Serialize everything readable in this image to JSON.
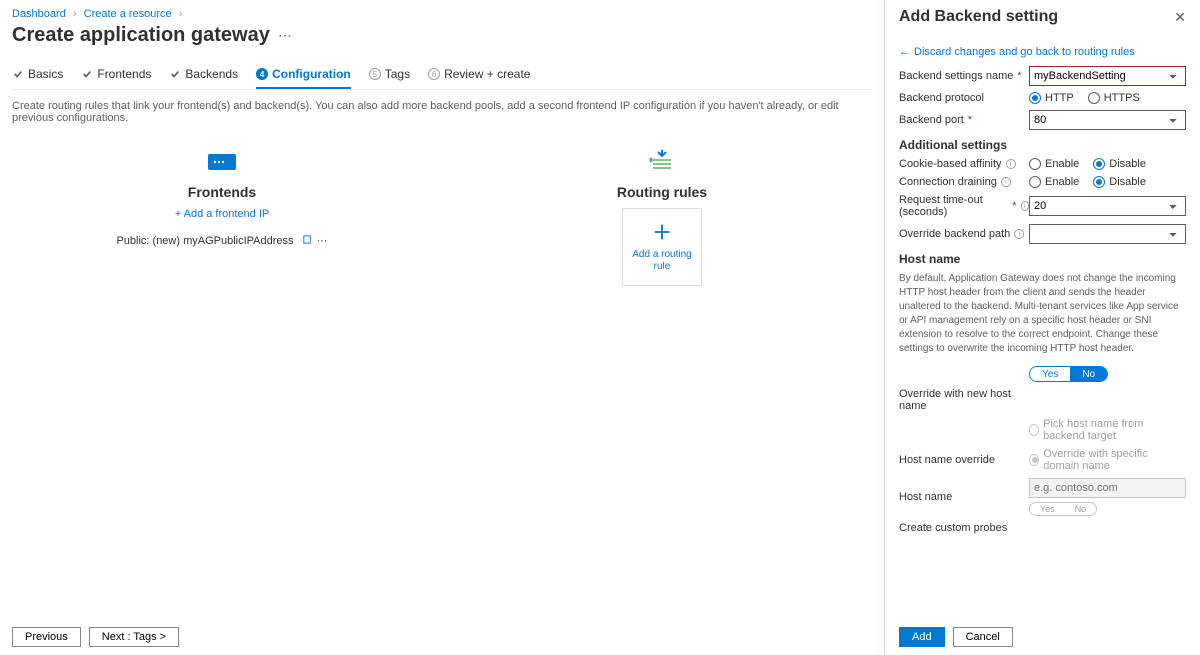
{
  "breadcrumb": {
    "dashboard": "Dashboard",
    "create_resource": "Create a resource"
  },
  "page_title": "Create application gateway",
  "tabs": {
    "basics": "Basics",
    "frontends": "Frontends",
    "backends": "Backends",
    "configuration": "Configuration",
    "tags_num": "5",
    "tags": "Tags",
    "review_num": "6",
    "review": "Review + create"
  },
  "intro": "Create routing rules that link your frontend(s) and backend(s). You can also add more backend pools, add a second frontend IP configuration if you haven't already, or edit previous configurations.",
  "frontends": {
    "title": "Frontends",
    "add_link": "+ Add a frontend IP",
    "item_label": "Public: (new) myAGPublicIPAddress"
  },
  "routing": {
    "title": "Routing rules",
    "add_label": "Add a routing rule"
  },
  "footer": {
    "previous": "Previous",
    "next": "Next : Tags >"
  },
  "panel": {
    "title": "Add Backend setting",
    "back": "Discard changes and go back to routing rules",
    "labels": {
      "name": "Backend settings name",
      "protocol": "Backend protocol",
      "port": "Backend port",
      "additional": "Additional settings",
      "affinity": "Cookie-based affinity",
      "draining": "Connection draining",
      "timeout": "Request time-out (seconds)",
      "override_path": "Override backend path",
      "hostname": "Host name",
      "override_new": "Override with new host name",
      "hostname_override": "Host name override",
      "host_name_field": "Host name",
      "custom_probes": "Create custom probes"
    },
    "values": {
      "name": "myBackendSetting",
      "port": "80",
      "timeout": "20",
      "hostname_placeholder": "e.g. contoso.com"
    },
    "radio": {
      "http": "HTTP",
      "https": "HTTPS",
      "enable": "Enable",
      "disable": "Disable",
      "pick": "Pick host name from backend target",
      "override_specific": "Override with specific domain name",
      "yes": "Yes",
      "no": "No"
    },
    "help": "By default, Application Gateway does not change the incoming HTTP host header from the client and sends the header unaltered to the backend. Multi-tenant services like App service or API management rely on a specific host header or SNI extension to resolve to the correct endpoint. Change these settings to overwrite the incoming HTTP host header.",
    "footer": {
      "add": "Add",
      "cancel": "Cancel"
    }
  }
}
